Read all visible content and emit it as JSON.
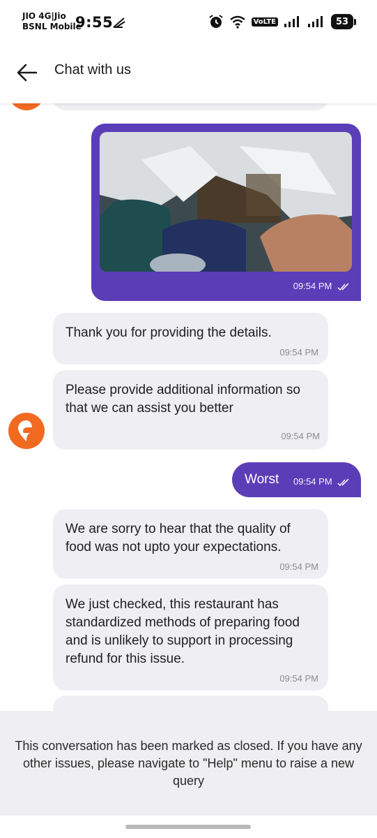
{
  "status_bar": {
    "carrier_line1": "JIO 4G|Jio",
    "carrier_line2": "BSNL Mobile",
    "time": "9:55",
    "volte": "VoLTE",
    "battery": "53",
    "icons": [
      "airplane-glyph-icon",
      "alarm-icon",
      "wifi-icon",
      "volte-icon",
      "signal-icon",
      "signal-icon",
      "battery-icon"
    ]
  },
  "header": {
    "title": "Chat with us",
    "back_icon": "arrow-left-icon"
  },
  "messages": [
    {
      "sender": "user",
      "type": "image",
      "time": "09:54 PM"
    },
    {
      "sender": "bot",
      "text": "Thank you for providing the details.",
      "time": "09:54 PM"
    },
    {
      "sender": "bot",
      "text": "Please provide additional information so that we can assist you better",
      "time": "09:54 PM"
    },
    {
      "sender": "user",
      "text": "Worst",
      "time": "09:54 PM"
    },
    {
      "sender": "bot",
      "text": "We are sorry to hear that the quality of food was not upto your expectations.",
      "time": "09:54 PM"
    },
    {
      "sender": "bot",
      "text": "We just checked, this restaurant has standardized methods of preparing food and is unlikely to support in processing refund for this issue.",
      "time": "09:54 PM"
    }
  ],
  "closed_notice": "This conversation has been marked as closed. If you have any other issues, please navigate to \"Help\" menu to raise a new query",
  "colors": {
    "user_bubble": "#5b3db8",
    "bot_bubble": "#efeff3",
    "brand_avatar": "#f26a22"
  }
}
